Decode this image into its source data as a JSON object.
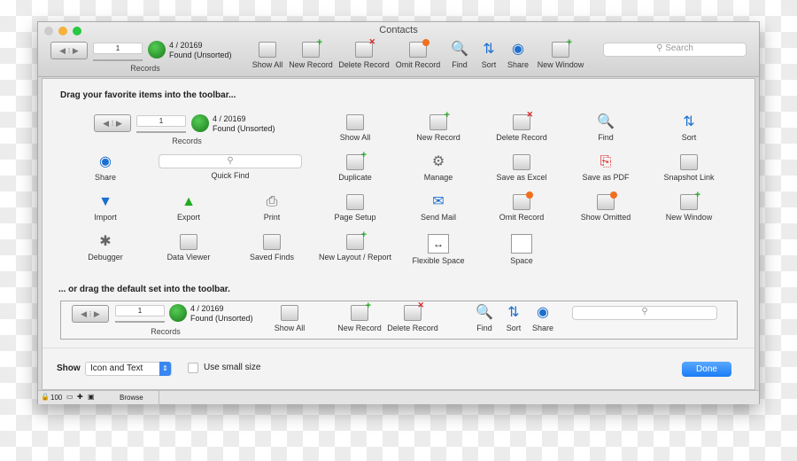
{
  "window": {
    "title": "Contacts"
  },
  "toolbar": {
    "record_number": "1",
    "found_count": "4 / 20169",
    "found_state": "Found (Unsorted)",
    "records_label": "Records",
    "buttons": [
      {
        "label": "Show All",
        "icon": "show-all-icon"
      },
      {
        "label": "New Record",
        "icon": "new-record-icon"
      },
      {
        "label": "Delete Record",
        "icon": "delete-record-icon"
      },
      {
        "label": "Omit Record",
        "icon": "omit-record-icon"
      },
      {
        "label": "Find",
        "icon": "find-icon"
      },
      {
        "label": "Sort",
        "icon": "sort-icon"
      },
      {
        "label": "Share",
        "icon": "share-icon"
      },
      {
        "label": "New Window",
        "icon": "new-window-icon"
      }
    ],
    "search_placeholder": "Search"
  },
  "sheet": {
    "heading": "Drag your favorite items into the toolbar...",
    "records": {
      "record_number": "1",
      "found_count": "4 / 20169",
      "found_state": "Found (Unsorted)",
      "label": "Records"
    },
    "items": [
      {
        "label": "Show All",
        "icon": "show-all-icon"
      },
      {
        "label": "New Record",
        "icon": "new-record-icon"
      },
      {
        "label": "Delete Record",
        "icon": "delete-record-icon"
      },
      {
        "label": "Find",
        "icon": "find-icon"
      },
      {
        "label": "Sort",
        "icon": "sort-icon"
      },
      {
        "label": "Share",
        "icon": "share-icon"
      },
      {
        "label": "Quick Find",
        "icon": "quick-find-field"
      },
      {
        "label": "Duplicate",
        "icon": "duplicate-icon"
      },
      {
        "label": "Manage",
        "icon": "manage-icon"
      },
      {
        "label": "Save as Excel",
        "icon": "excel-icon"
      },
      {
        "label": "Save as PDF",
        "icon": "pdf-icon"
      },
      {
        "label": "Snapshot Link",
        "icon": "snapshot-link-icon"
      },
      {
        "label": "Import",
        "icon": "import-icon"
      },
      {
        "label": "Export",
        "icon": "export-icon"
      },
      {
        "label": "Print",
        "icon": "print-icon"
      },
      {
        "label": "Page Setup",
        "icon": "page-setup-icon"
      },
      {
        "label": "Send Mail",
        "icon": "send-mail-icon"
      },
      {
        "label": "Omit Record",
        "icon": "omit-record-icon"
      },
      {
        "label": "Show Omitted",
        "icon": "show-omitted-icon"
      },
      {
        "label": "New Window",
        "icon": "new-window-icon"
      },
      {
        "label": "Debugger",
        "icon": "debugger-icon"
      },
      {
        "label": "Data Viewer",
        "icon": "data-viewer-icon"
      },
      {
        "label": "Saved Finds",
        "icon": "saved-finds-icon"
      },
      {
        "label": "New Layout / Report",
        "icon": "new-layout-icon"
      },
      {
        "label": "Flexible Space",
        "icon": "flexible-space-icon"
      },
      {
        "label": "Space",
        "icon": "space-icon"
      }
    ],
    "default_heading": "... or drag the default set into the toolbar.",
    "default_set": [
      {
        "label": "Show All"
      },
      {
        "label": "New Record"
      },
      {
        "label": "Delete Record"
      },
      {
        "label": "Find"
      },
      {
        "label": "Sort"
      },
      {
        "label": "Share"
      }
    ],
    "show_label": "Show",
    "show_value": "Icon and Text",
    "small_size_label": "Use small size",
    "small_size_checked": false,
    "done_label": "Done"
  },
  "statusbar": {
    "zoom": "100",
    "mode": "Browse"
  },
  "colors": {
    "accent": "#1a7cf5",
    "close": "#ccc",
    "minimize": "#f5b13a",
    "zoom": "#28c840"
  }
}
